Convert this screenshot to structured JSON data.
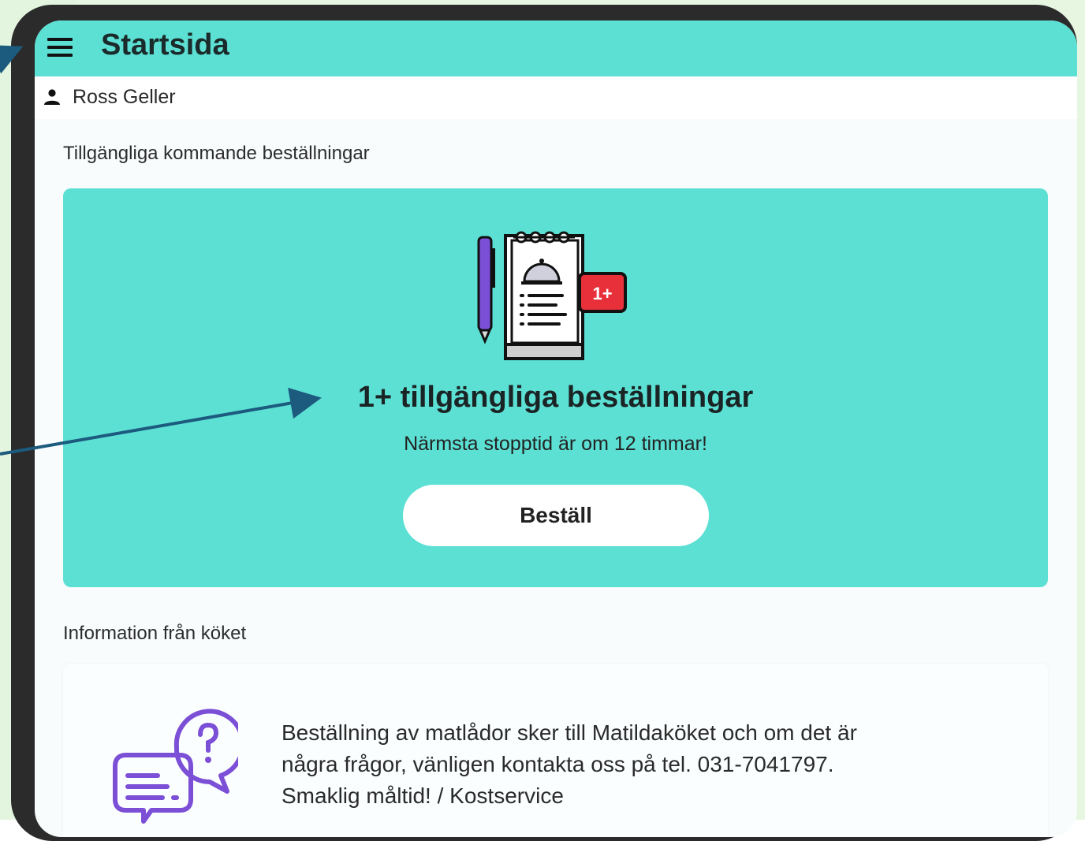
{
  "header": {
    "title": "Startsida",
    "menu_icon": "hamburger-menu-icon"
  },
  "user": {
    "name": "Ross Geller",
    "icon": "person-icon"
  },
  "orders_section": {
    "label": "Tillgängliga kommande beställningar",
    "badge": "1+",
    "headline": "1+ tillgängliga beställningar",
    "subtext": "Närmsta stopptid är om 12 timmar!",
    "button_label": "Beställ",
    "illustration_icon": "order-notepad-icon"
  },
  "info_section": {
    "label": "Information från köket",
    "icon": "chat-question-icon",
    "text": "Beställning av matlådor sker till Matildaköket och om det är\nnågra frågor, vänligen kontakta oss på tel. 031-7041797.\nSmaklig måltid! / Kostservice"
  },
  "colors": {
    "accent": "#5ce0d4",
    "device_frame": "#2b2b2b",
    "annotation_arrow": "#1c5a7e",
    "badge_red": "#e8303a",
    "icon_purple": "#7b4fd6"
  }
}
